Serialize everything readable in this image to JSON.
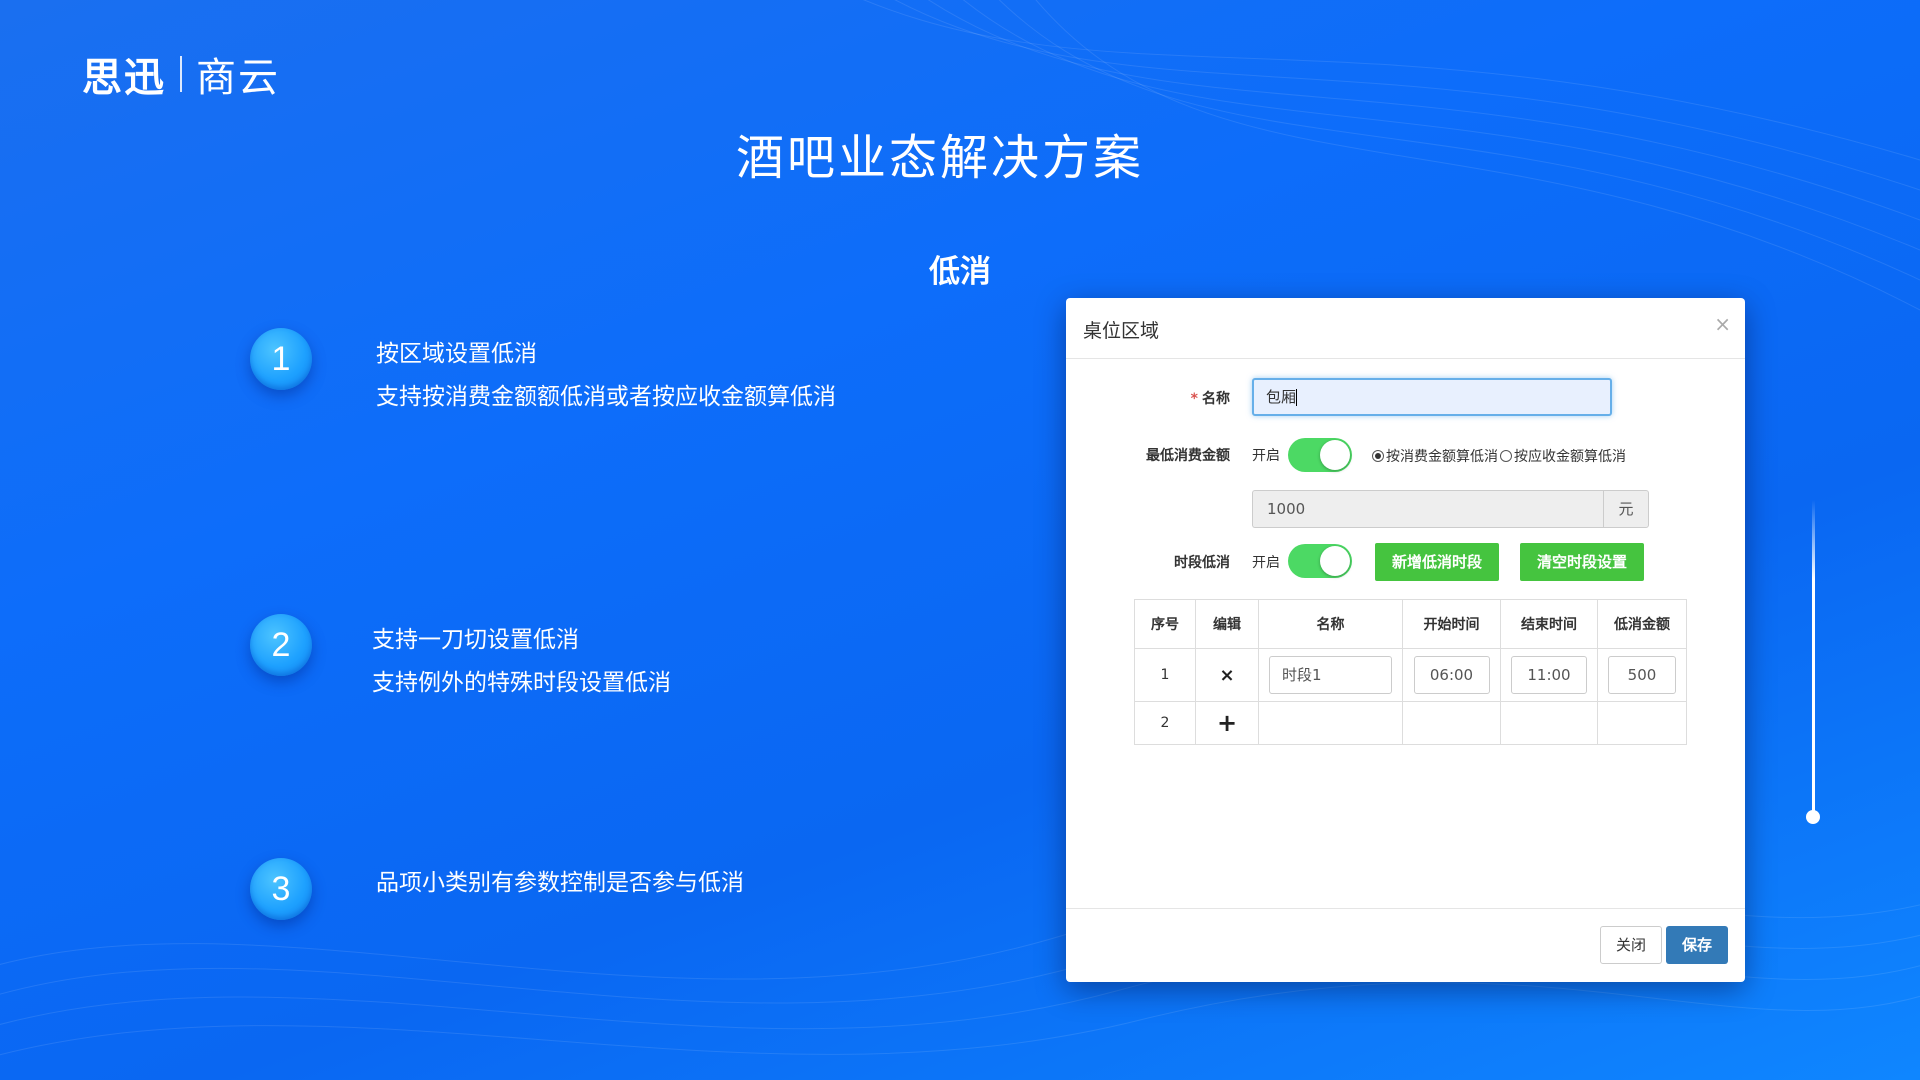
{
  "header": {
    "brand": "思迅",
    "sub_brand": "商云",
    "title": "酒吧业态解决方案",
    "section": "低消"
  },
  "features": [
    {
      "number": "1",
      "line1": "按区域设置低消",
      "line2": "支持按消费金额额低消或者按应收金额算低消"
    },
    {
      "number": "2",
      "line1": "支持一刀切设置低消",
      "line2": "支持例外的特殊时段设置低消"
    },
    {
      "number": "3",
      "line1": "品项小类别有参数控制是否参与低消",
      "line2": ""
    }
  ],
  "modal": {
    "title": "桌位区域",
    "close_icon": "×",
    "name_label": "名称",
    "required_mark": "*",
    "name_value": "包厢",
    "min_spend_label": "最低消费金额",
    "toggle_on_label": "开启",
    "radio_by_spend": "按消费金额算低消",
    "radio_by_receivable": "按应收金额算低消",
    "min_spend_selected": "按消费金额算低消",
    "min_spend_amount": "1000",
    "currency_addon": "元",
    "period_label": "时段低消",
    "period_toggle_label": "开启",
    "add_period_button": "新增低消时段",
    "clear_period_button": "清空时段设置",
    "table": {
      "headers": [
        "序号",
        "编辑",
        "名称",
        "开始时间",
        "结束时间",
        "低消金额"
      ],
      "rows": [
        {
          "index": "1",
          "action_icon": "×",
          "name": "时段1",
          "start": "06:00",
          "end": "11:00",
          "amount": "500"
        },
        {
          "index": "2",
          "action_icon": "+",
          "name": "",
          "start": "",
          "end": "",
          "amount": ""
        }
      ]
    },
    "close_button": "关闭",
    "save_button": "保存"
  },
  "colors": {
    "background": "#0d6dfa",
    "toggle_on": "#4cd964",
    "green_button": "#45c43f",
    "primary_button": "#337ab7",
    "number_circle": "#1ea1ff"
  }
}
